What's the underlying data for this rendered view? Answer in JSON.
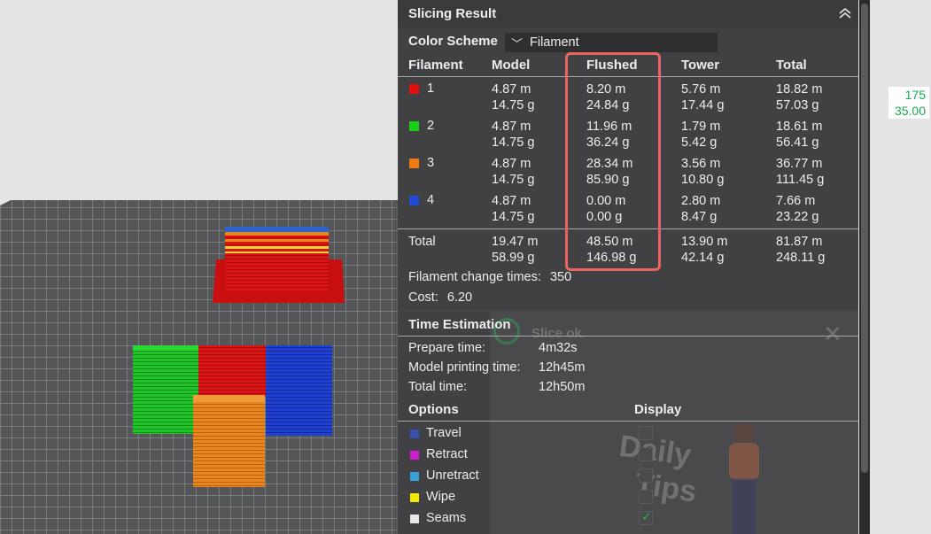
{
  "panel": {
    "title": "Slicing Result",
    "color_scheme_label": "Color Scheme",
    "color_scheme_value": "Filament",
    "columns": [
      "Filament",
      "Model",
      "Flushed",
      "Tower",
      "Total"
    ],
    "filaments": [
      {
        "id": "1",
        "color": "#e01010",
        "model": [
          "4.87 m",
          "14.75 g"
        ],
        "flushed": [
          "8.20 m",
          "24.84 g"
        ],
        "tower": [
          "5.76 m",
          "17.44 g"
        ],
        "total": [
          "18.82 m",
          "57.03 g"
        ]
      },
      {
        "id": "2",
        "color": "#18d018",
        "model": [
          "4.87 m",
          "14.75 g"
        ],
        "flushed": [
          "11.96 m",
          "36.24 g"
        ],
        "tower": [
          "1.79 m",
          "5.42 g"
        ],
        "total": [
          "18.61 m",
          "56.41 g"
        ]
      },
      {
        "id": "3",
        "color": "#f07a12",
        "model": [
          "4.87 m",
          "14.75 g"
        ],
        "flushed": [
          "28.34 m",
          "85.90 g"
        ],
        "tower": [
          "3.56 m",
          "10.80 g"
        ],
        "total": [
          "36.77 m",
          "111.45 g"
        ]
      },
      {
        "id": "4",
        "color": "#2448d8",
        "model": [
          "4.87 m",
          "14.75 g"
        ],
        "flushed": [
          "0.00 m",
          "0.00 g"
        ],
        "tower": [
          "2.80 m",
          "8.47 g"
        ],
        "total": [
          "7.66 m",
          "23.22 g"
        ]
      }
    ],
    "total_row": {
      "label": "Total",
      "model": [
        "19.47 m",
        "58.99 g"
      ],
      "flushed": [
        "48.50 m",
        "146.98 g"
      ],
      "tower": [
        "13.90 m",
        "42.14 g"
      ],
      "total": [
        "81.87 m",
        "248.11 g"
      ]
    },
    "filament_change_label": "Filament change times:",
    "filament_change_value": "350",
    "cost_label": "Cost:",
    "cost_value": "6.20",
    "time_title": "Time Estimation",
    "prepare_label": "Prepare time:",
    "prepare_value": "4m32s",
    "model_print_label": "Model printing time:",
    "model_print_value": "12h45m",
    "total_time_label": "Total time:",
    "total_time_value": "12h50m",
    "options_title": "Options",
    "display_title": "Display",
    "options": [
      {
        "label": "Travel",
        "color": "#3b4fb0",
        "checked": false
      },
      {
        "label": "Retract",
        "color": "#d21ed2",
        "checked": false
      },
      {
        "label": "Unretract",
        "color": "#3aa0d8",
        "checked": false
      },
      {
        "label": "Wipe",
        "color": "#f5e800",
        "checked": false
      },
      {
        "label": "Seams",
        "color": "#e8e8e8",
        "checked": true
      }
    ]
  },
  "ghost": {
    "slice_status": "Slice ok.",
    "tips_word1": "Daily",
    "tips_word2": "Tips"
  },
  "layer_readout": {
    "top": "175",
    "bottom": "35.00"
  },
  "colors": {
    "flushed_highlight": "#e8665f",
    "panel_bg": "#363638",
    "readout_green": "#1aa84a"
  }
}
